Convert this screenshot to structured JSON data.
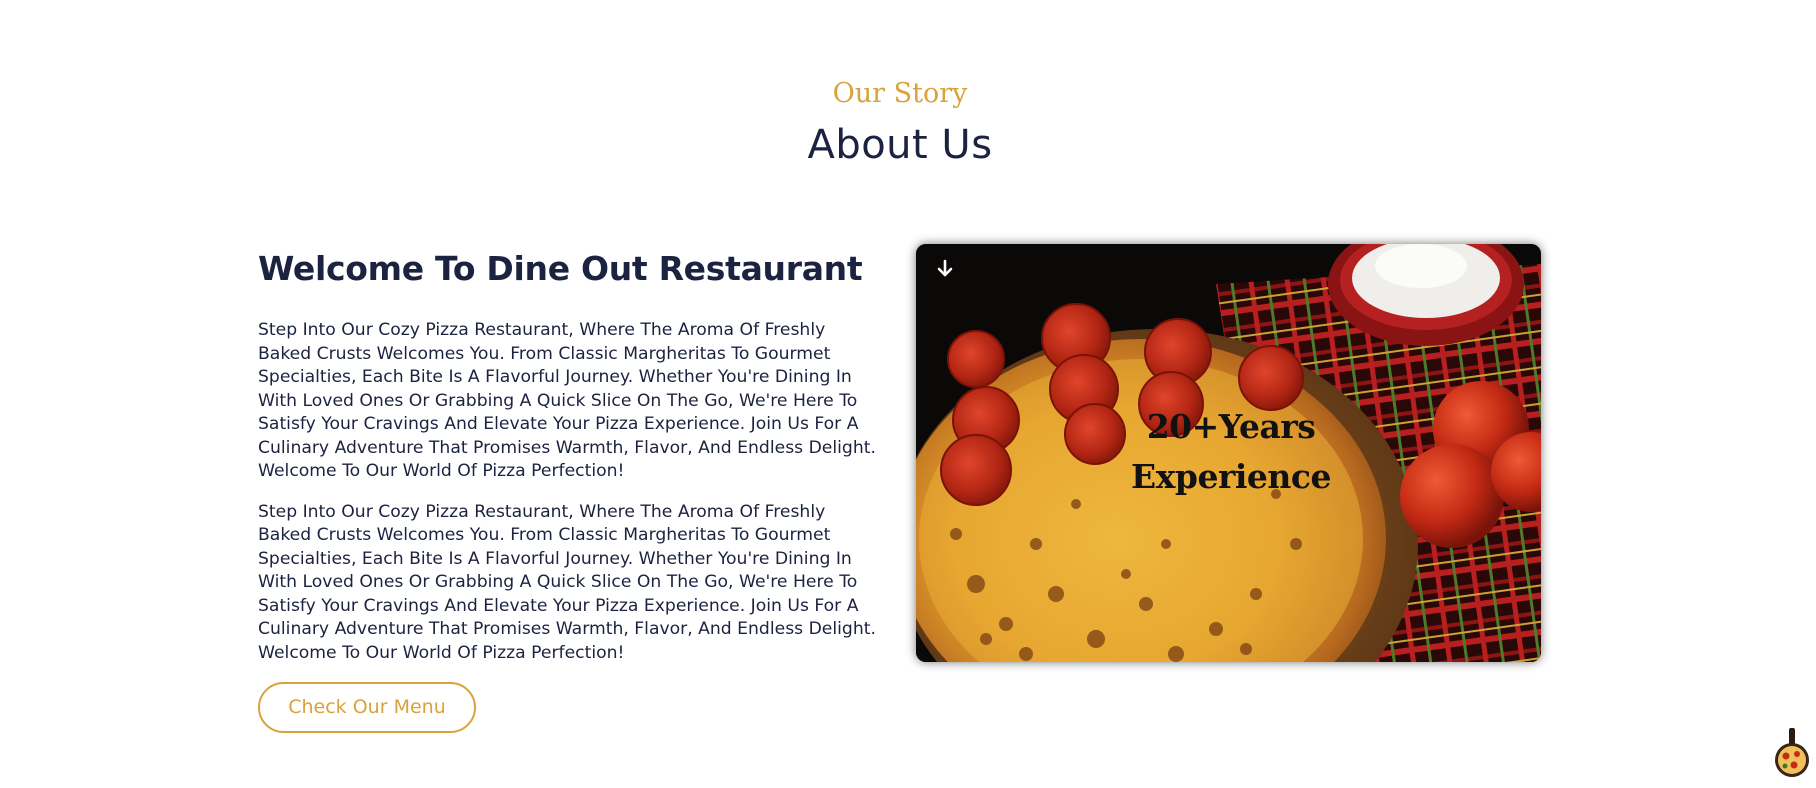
{
  "section": {
    "eyebrow": "Our Story",
    "heading": "About Us"
  },
  "content": {
    "title": "Welcome To Dine Out Restaurant",
    "paragraphs": [
      "Step Into Our Cozy Pizza Restaurant, Where The Aroma Of Freshly Baked Crusts Welcomes You. From Classic Margheritas To Gourmet Specialties, Each Bite Is A Flavorful Journey. Whether You're Dining In With Loved Ones Or Grabbing A Quick Slice On The Go, We're Here To Satisfy Your Cravings And Elevate Your Pizza Experience. Join Us For A Culinary Adventure That Promises Warmth, Flavor, And Endless Delight. Welcome To Our World Of Pizza Perfection!",
      "Step Into Our Cozy Pizza Restaurant, Where The Aroma Of Freshly Baked Crusts Welcomes You. From Classic Margheritas To Gourmet Specialties, Each Bite Is A Flavorful Journey. Whether You're Dining In With Loved Ones Or Grabbing A Quick Slice On The Go, We're Here To Satisfy Your Cravings And Elevate Your Pizza Experience. Join Us For A Culinary Adventure That Promises Warmth, Flavor, And Endless Delight. Welcome To Our World Of Pizza Perfection!"
    ],
    "button_label": "Check Our Menu"
  },
  "image": {
    "experience_line1": "20+Years",
    "experience_line2": "Experience",
    "icon": "arrow-down-icon"
  },
  "colors": {
    "accent": "#d9a23a",
    "text": "#1c2340"
  }
}
